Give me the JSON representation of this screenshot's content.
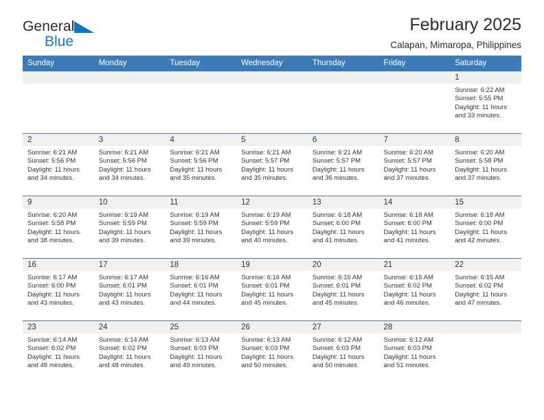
{
  "brand": {
    "name_part1": "General",
    "name_part2": "Blue",
    "triangle_color": "#1278be"
  },
  "header": {
    "title": "February 2025",
    "subtitle": "Calapan, Mimaropa, Philippines"
  },
  "calendar": {
    "header_bg": "#3b7cb8",
    "daynum_bg": "#f0f0f0",
    "weekdays": [
      "Sunday",
      "Monday",
      "Tuesday",
      "Wednesday",
      "Thursday",
      "Friday",
      "Saturday"
    ],
    "weeks": [
      [
        {
          "day": "",
          "sunrise": "",
          "sunset": "",
          "daylight_line1": "",
          "daylight_line2": ""
        },
        {
          "day": "",
          "sunrise": "",
          "sunset": "",
          "daylight_line1": "",
          "daylight_line2": ""
        },
        {
          "day": "",
          "sunrise": "",
          "sunset": "",
          "daylight_line1": "",
          "daylight_line2": ""
        },
        {
          "day": "",
          "sunrise": "",
          "sunset": "",
          "daylight_line1": "",
          "daylight_line2": ""
        },
        {
          "day": "",
          "sunrise": "",
          "sunset": "",
          "daylight_line1": "",
          "daylight_line2": ""
        },
        {
          "day": "",
          "sunrise": "",
          "sunset": "",
          "daylight_line1": "",
          "daylight_line2": ""
        },
        {
          "day": "1",
          "sunrise": "Sunrise: 6:22 AM",
          "sunset": "Sunset: 5:55 PM",
          "daylight_line1": "Daylight: 11 hours",
          "daylight_line2": "and 33 minutes."
        }
      ],
      [
        {
          "day": "2",
          "sunrise": "Sunrise: 6:21 AM",
          "sunset": "Sunset: 5:56 PM",
          "daylight_line1": "Daylight: 11 hours",
          "daylight_line2": "and 34 minutes."
        },
        {
          "day": "3",
          "sunrise": "Sunrise: 6:21 AM",
          "sunset": "Sunset: 5:56 PM",
          "daylight_line1": "Daylight: 11 hours",
          "daylight_line2": "and 34 minutes."
        },
        {
          "day": "4",
          "sunrise": "Sunrise: 6:21 AM",
          "sunset": "Sunset: 5:56 PM",
          "daylight_line1": "Daylight: 11 hours",
          "daylight_line2": "and 35 minutes."
        },
        {
          "day": "5",
          "sunrise": "Sunrise: 6:21 AM",
          "sunset": "Sunset: 5:57 PM",
          "daylight_line1": "Daylight: 11 hours",
          "daylight_line2": "and 35 minutes."
        },
        {
          "day": "6",
          "sunrise": "Sunrise: 6:21 AM",
          "sunset": "Sunset: 5:57 PM",
          "daylight_line1": "Daylight: 11 hours",
          "daylight_line2": "and 36 minutes."
        },
        {
          "day": "7",
          "sunrise": "Sunrise: 6:20 AM",
          "sunset": "Sunset: 5:57 PM",
          "daylight_line1": "Daylight: 11 hours",
          "daylight_line2": "and 37 minutes."
        },
        {
          "day": "8",
          "sunrise": "Sunrise: 6:20 AM",
          "sunset": "Sunset: 5:58 PM",
          "daylight_line1": "Daylight: 11 hours",
          "daylight_line2": "and 37 minutes."
        }
      ],
      [
        {
          "day": "9",
          "sunrise": "Sunrise: 6:20 AM",
          "sunset": "Sunset: 5:58 PM",
          "daylight_line1": "Daylight: 11 hours",
          "daylight_line2": "and 38 minutes."
        },
        {
          "day": "10",
          "sunrise": "Sunrise: 6:19 AM",
          "sunset": "Sunset: 5:59 PM",
          "daylight_line1": "Daylight: 11 hours",
          "daylight_line2": "and 39 minutes."
        },
        {
          "day": "11",
          "sunrise": "Sunrise: 6:19 AM",
          "sunset": "Sunset: 5:59 PM",
          "daylight_line1": "Daylight: 11 hours",
          "daylight_line2": "and 39 minutes."
        },
        {
          "day": "12",
          "sunrise": "Sunrise: 6:19 AM",
          "sunset": "Sunset: 5:59 PM",
          "daylight_line1": "Daylight: 11 hours",
          "daylight_line2": "and 40 minutes."
        },
        {
          "day": "13",
          "sunrise": "Sunrise: 6:18 AM",
          "sunset": "Sunset: 6:00 PM",
          "daylight_line1": "Daylight: 11 hours",
          "daylight_line2": "and 41 minutes."
        },
        {
          "day": "14",
          "sunrise": "Sunrise: 6:18 AM",
          "sunset": "Sunset: 6:00 PM",
          "daylight_line1": "Daylight: 11 hours",
          "daylight_line2": "and 41 minutes."
        },
        {
          "day": "15",
          "sunrise": "Sunrise: 6:18 AM",
          "sunset": "Sunset: 6:00 PM",
          "daylight_line1": "Daylight: 11 hours",
          "daylight_line2": "and 42 minutes."
        }
      ],
      [
        {
          "day": "16",
          "sunrise": "Sunrise: 6:17 AM",
          "sunset": "Sunset: 6:00 PM",
          "daylight_line1": "Daylight: 11 hours",
          "daylight_line2": "and 43 minutes."
        },
        {
          "day": "17",
          "sunrise": "Sunrise: 6:17 AM",
          "sunset": "Sunset: 6:01 PM",
          "daylight_line1": "Daylight: 11 hours",
          "daylight_line2": "and 43 minutes."
        },
        {
          "day": "18",
          "sunrise": "Sunrise: 6:16 AM",
          "sunset": "Sunset: 6:01 PM",
          "daylight_line1": "Daylight: 11 hours",
          "daylight_line2": "and 44 minutes."
        },
        {
          "day": "19",
          "sunrise": "Sunrise: 6:16 AM",
          "sunset": "Sunset: 6:01 PM",
          "daylight_line1": "Daylight: 11 hours",
          "daylight_line2": "and 45 minutes."
        },
        {
          "day": "20",
          "sunrise": "Sunrise: 6:16 AM",
          "sunset": "Sunset: 6:01 PM",
          "daylight_line1": "Daylight: 11 hours",
          "daylight_line2": "and 45 minutes."
        },
        {
          "day": "21",
          "sunrise": "Sunrise: 6:15 AM",
          "sunset": "Sunset: 6:02 PM",
          "daylight_line1": "Daylight: 11 hours",
          "daylight_line2": "and 46 minutes."
        },
        {
          "day": "22",
          "sunrise": "Sunrise: 6:15 AM",
          "sunset": "Sunset: 6:02 PM",
          "daylight_line1": "Daylight: 11 hours",
          "daylight_line2": "and 47 minutes."
        }
      ],
      [
        {
          "day": "23",
          "sunrise": "Sunrise: 6:14 AM",
          "sunset": "Sunset: 6:02 PM",
          "daylight_line1": "Daylight: 11 hours",
          "daylight_line2": "and 48 minutes."
        },
        {
          "day": "24",
          "sunrise": "Sunrise: 6:14 AM",
          "sunset": "Sunset: 6:02 PM",
          "daylight_line1": "Daylight: 11 hours",
          "daylight_line2": "and 48 minutes."
        },
        {
          "day": "25",
          "sunrise": "Sunrise: 6:13 AM",
          "sunset": "Sunset: 6:03 PM",
          "daylight_line1": "Daylight: 11 hours",
          "daylight_line2": "and 49 minutes."
        },
        {
          "day": "26",
          "sunrise": "Sunrise: 6:13 AM",
          "sunset": "Sunset: 6:03 PM",
          "daylight_line1": "Daylight: 11 hours",
          "daylight_line2": "and 50 minutes."
        },
        {
          "day": "27",
          "sunrise": "Sunrise: 6:12 AM",
          "sunset": "Sunset: 6:03 PM",
          "daylight_line1": "Daylight: 11 hours",
          "daylight_line2": "and 50 minutes."
        },
        {
          "day": "28",
          "sunrise": "Sunrise: 6:12 AM",
          "sunset": "Sunset: 6:03 PM",
          "daylight_line1": "Daylight: 11 hours",
          "daylight_line2": "and 51 minutes."
        },
        {
          "day": "",
          "sunrise": "",
          "sunset": "",
          "daylight_line1": "",
          "daylight_line2": ""
        }
      ]
    ]
  }
}
